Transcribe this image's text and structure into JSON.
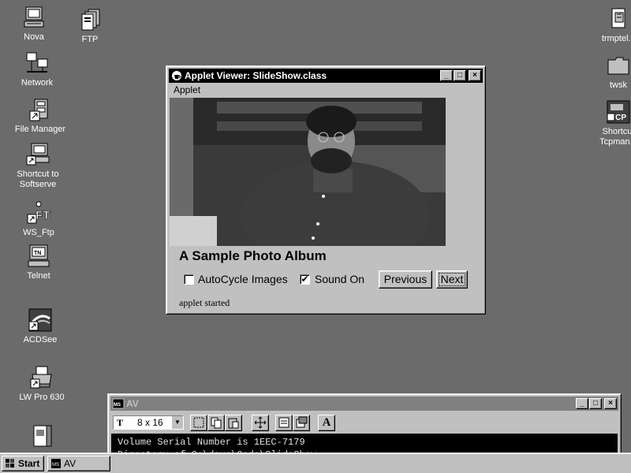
{
  "desktop": {
    "icons_left": [
      {
        "label": "Nova",
        "icon": "computer-icon"
      },
      {
        "label": "Network",
        "icon": "network-icon"
      },
      {
        "label": "File Manager",
        "icon": "file-manager-icon"
      },
      {
        "label": "Shortcut to",
        "label2": "Softserve",
        "icon": "shortcut-computer-icon"
      },
      {
        "label": "WS_Ftp",
        "icon": "ftp-shortcut-icon"
      },
      {
        "label": "Telnet",
        "icon": "telnet-icon"
      },
      {
        "label": "ACDSee",
        "icon": "acdsee-icon"
      },
      {
        "label": "LW Pro 630",
        "icon": "printer-icon"
      }
    ],
    "icon_ftp": {
      "label": "FTP",
      "icon": "ftp-folder-icon"
    },
    "icons_right": [
      {
        "label": "trmptel.z",
        "icon": "zip-file-icon"
      },
      {
        "label": "twsk",
        "icon": "folder-icon"
      },
      {
        "label": "Shortcut",
        "label2": "Tcpman.e",
        "icon": "tcp-shortcut-icon",
        "badge": "TCP"
      }
    ]
  },
  "applet_window": {
    "title": "Applet Viewer: SlideShow.class",
    "menu": [
      "Applet"
    ],
    "photo_heading": "A Sample Photo Album",
    "autocycle_label": "AutoCycle Images",
    "autocycle_checked": false,
    "sound_label": "Sound On",
    "sound_checked": true,
    "previous_label": "Previous",
    "next_label": "Next",
    "status": "applet started",
    "minimize": "_",
    "maximize": "□",
    "close": "×"
  },
  "av_window": {
    "title": "AV",
    "font_label": "T",
    "font_size": "8 x 16",
    "console_lines": [
      "Volume Serial Number is 1EEC-7179",
      "Directory of C:\\dave\\Code\\SlideShow"
    ],
    "tool_a": "A"
  },
  "taskbar": {
    "start_label": "Start",
    "tasks": [
      {
        "label": "AV"
      }
    ]
  }
}
